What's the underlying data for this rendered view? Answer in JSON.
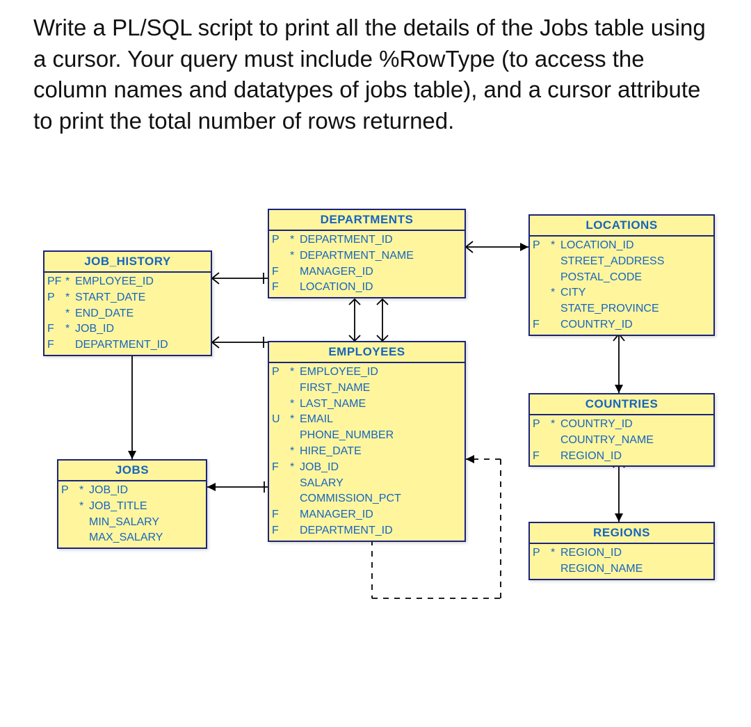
{
  "question": "Write a PL/SQL script to print all the details of the Jobs table using a cursor. Your query must include %RowType (to access the column names and datatypes of jobs table), and a cursor attribute to print the total number of rows returned.",
  "entities": {
    "job_history": {
      "title": "JOB_HISTORY",
      "cols": [
        {
          "key": "PF",
          "star": "*",
          "name": "EMPLOYEE_ID"
        },
        {
          "key": "P",
          "star": "*",
          "name": "START_DATE"
        },
        {
          "key": "",
          "star": "*",
          "name": "END_DATE"
        },
        {
          "key": "F",
          "star": "*",
          "name": "JOB_ID"
        },
        {
          "key": "F",
          "star": "",
          "name": "DEPARTMENT_ID"
        }
      ]
    },
    "departments": {
      "title": "DEPARTMENTS",
      "cols": [
        {
          "key": "P",
          "star": "*",
          "name": "DEPARTMENT_ID"
        },
        {
          "key": "",
          "star": "*",
          "name": "DEPARTMENT_NAME"
        },
        {
          "key": "F",
          "star": "",
          "name": "MANAGER_ID"
        },
        {
          "key": "F",
          "star": "",
          "name": "LOCATION_ID"
        }
      ]
    },
    "locations": {
      "title": "LOCATIONS",
      "cols": [
        {
          "key": "P",
          "star": "*",
          "name": "LOCATION_ID"
        },
        {
          "key": "",
          "star": "",
          "name": "STREET_ADDRESS"
        },
        {
          "key": "",
          "star": "",
          "name": "POSTAL_CODE"
        },
        {
          "key": "",
          "star": "*",
          "name": "CITY"
        },
        {
          "key": "",
          "star": "",
          "name": "STATE_PROVINCE"
        },
        {
          "key": "F",
          "star": "",
          "name": "COUNTRY_ID"
        }
      ]
    },
    "employees": {
      "title": "EMPLOYEES",
      "cols": [
        {
          "key": "P",
          "star": "*",
          "name": "EMPLOYEE_ID"
        },
        {
          "key": "",
          "star": "",
          "name": "FIRST_NAME"
        },
        {
          "key": "",
          "star": "*",
          "name": "LAST_NAME"
        },
        {
          "key": "U",
          "star": "*",
          "name": "EMAIL"
        },
        {
          "key": "",
          "star": "",
          "name": "PHONE_NUMBER"
        },
        {
          "key": "",
          "star": "*",
          "name": "HIRE_DATE"
        },
        {
          "key": "F",
          "star": "*",
          "name": "JOB_ID"
        },
        {
          "key": "",
          "star": "",
          "name": "SALARY"
        },
        {
          "key": "",
          "star": "",
          "name": "COMMISSION_PCT"
        },
        {
          "key": "F",
          "star": "",
          "name": "MANAGER_ID"
        },
        {
          "key": "F",
          "star": "",
          "name": "DEPARTMENT_ID"
        }
      ]
    },
    "jobs": {
      "title": "JOBS",
      "cols": [
        {
          "key": "P",
          "star": "*",
          "name": "JOB_ID"
        },
        {
          "key": "",
          "star": "*",
          "name": "JOB_TITLE"
        },
        {
          "key": "",
          "star": "",
          "name": "MIN_SALARY"
        },
        {
          "key": "",
          "star": "",
          "name": "MAX_SALARY"
        }
      ]
    },
    "countries": {
      "title": "COUNTRIES",
      "cols": [
        {
          "key": "P",
          "star": "*",
          "name": "COUNTRY_ID"
        },
        {
          "key": "",
          "star": "",
          "name": "COUNTRY_NAME"
        },
        {
          "key": "F",
          "star": "",
          "name": "REGION_ID"
        }
      ]
    },
    "regions": {
      "title": "REGIONS",
      "cols": [
        {
          "key": "P",
          "star": "*",
          "name": "REGION_ID"
        },
        {
          "key": "",
          "star": "",
          "name": "REGION_NAME"
        }
      ]
    }
  }
}
